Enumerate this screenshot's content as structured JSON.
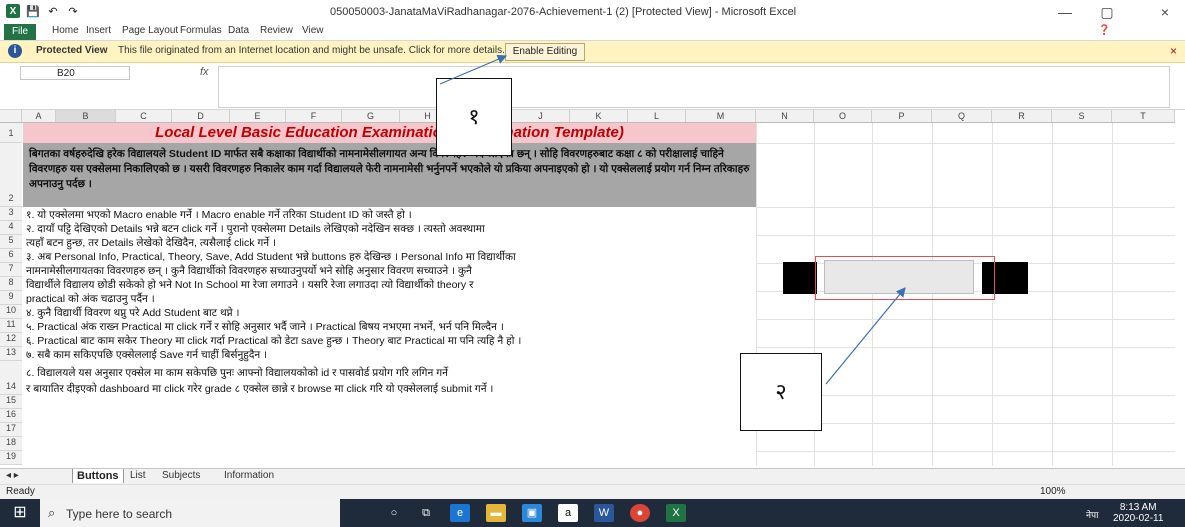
{
  "window": {
    "title": "050050003-JanataMaViRadhanagar-2076-Achievement-1 (2)  [Protected View] - Microsoft Excel",
    "min": "—",
    "max": "▢",
    "close": "×"
  },
  "ribbon": {
    "tabs": [
      "File",
      "Home",
      "Insert",
      "Page Layout",
      "Formulas",
      "Data",
      "Review",
      "View"
    ]
  },
  "protected_view": {
    "label": "Protected View",
    "message": "This file originated from an Internet location and might be unsafe. Click for more details.",
    "button": "Enable Editing",
    "close": "×"
  },
  "formula_bar": {
    "name_box": "B20",
    "fx": "fx",
    "value": ""
  },
  "columns": [
    "A",
    "B",
    "C",
    "D",
    "E",
    "F",
    "G",
    "H",
    "I",
    "J",
    "K",
    "L",
    "M",
    "N",
    "O",
    "P",
    "Q",
    "R",
    "S",
    "T"
  ],
  "rows": [
    "1",
    "2",
    "3",
    "4",
    "5",
    "6",
    "7",
    "8",
    "9",
    "10",
    "11",
    "12",
    "13",
    "14",
    "15",
    "16",
    "17",
    "18",
    "19"
  ],
  "sheet": {
    "title": "Local Level Basic Education Examination (Examination Template)",
    "intro": "बिगतका वर्षहरुदेखि हरेक विद्यालयले Student ID मार्फत सबै कक्षाका विद्यार्थीको नामनामेसीलगायत अन्य विवरणहरु भर्दै आएका छन् । सोहि विवरणहरुबाट कक्षा ८ को परीक्षालाई चाहिने विवरणहरु यस एक्सेलमा निकालिएको छ । यसरी विवरणहरु निकालेर काम गर्दा विद्यालयले फेरी नामनामेसी भर्नुनपर्ने भएकोले यो प्रकिया अपनाइएको हो । यो एक्सेललाई प्रयोग गर्न निम्न तरिकाहरु अपनाउनु पर्दछ ।",
    "lines": [
      "१. यो एक्सेलमा भएको Macro enable गर्ने । Macro enable गर्ने तरिका Student ID को जस्तै हो ।",
      "२. दायाँ पट्टि देखिएको Details भन्ने बटन click गर्ने । पुरानो एक्सेलमा Details लेखिएको नदेखिन सक्छ । त्यस्तो अवस्थामा",
      "त्यहाँ बटन हुन्छ, तर Details लेखेको देखिदैन, त्यसैलाई click गर्ने ।",
      "३. अब Personal Info, Practical, Theory, Save, Add Student भन्ने buttons हरु देखिन्छ । Personal Info मा विद्यार्थीका",
      "नामनामेसीलगायतका विवरणहरु छन् । कुनै विद्यार्थीको विवरणहरु सच्याउनुपर्यो भने सोहि अनुसार विवरण सच्याउने । कुनै",
      "विद्यार्थीले विद्यालय छोडी सकेको हो भने Not In School मा रेजा लगाउने । यसरि रेजा लगाउदा त्यो विद्यार्थीको theory र",
      "practical को अंक चढाउनु पर्दैन ।",
      "४. कुनै विद्यार्थी विवरण थप्नु परे Add Student बाट थप्ने ।",
      "५. Practical अंक राख्न Practical मा click गर्ने र सोहि अनुसार भर्दै जाने । Practical बिषय नभएमा नभर्ने, भर्न पनि मिल्दैन ।",
      "६. Practical बाट काम सकेर Theory मा click गर्दा Practical को डेटा save हुन्छ । Theory बाट Practical मा पनि त्यहि नै हो ।",
      "७. सबै काम सकिएपछि एक्सेललाई Save गर्न चाहीं बिर्सनुहुदैन ।",
      "८. विद्यालयले यस अनुसार एक्सेल मा काम सकेपछि पुनः आफ्नो विद्यालयकोको id र पासवोर्ड प्रयोग गरि लगिन गर्ने",
      "र बायातिर दीइएको dashboard मा click गरेर grade ८ एक्सेल छान्ने र browse मा click गरि यो एक्सेललाई submit गर्ने ।"
    ]
  },
  "annotations": {
    "one": "१",
    "two": "२"
  },
  "sheet_tabs": [
    "Buttons",
    "List",
    "Subjects",
    "Information"
  ],
  "status": {
    "ready": "Ready",
    "zoom": "100%"
  },
  "taskbar": {
    "search_placeholder": "Type here to search",
    "lang": "नेपा",
    "time": "8:13 AM",
    "date": "2020-02-11"
  }
}
